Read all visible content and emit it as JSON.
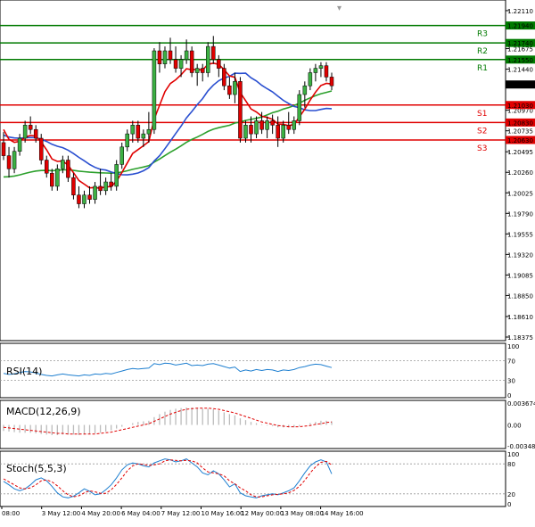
{
  "chart_data": [
    {
      "type": "candlestick",
      "title": "",
      "ylim": [
        1.18375,
        1.2215
      ],
      "yticks": [
        "1.22110",
        "1.21675",
        "1.21440",
        "1.21265",
        "1.20970",
        "1.20735",
        "1.20495",
        "1.20260",
        "1.20025",
        "1.19790",
        "1.19555",
        "1.19320",
        "1.19085",
        "1.18850",
        "1.18610",
        "1.18375"
      ],
      "xticks": [
        "08:00",
        "3 May 12:00",
        "4 May 20:00",
        "6 May 04:00",
        "7 May 12:00",
        "10 May 16:00",
        "12 May 00:00",
        "13 May 08:00",
        "14 May 16:00"
      ],
      "last_price": "1.21265",
      "levels": [
        {
          "name": "R3",
          "value": 1.2194,
          "label": "1.21940",
          "color": "#007a00"
        },
        {
          "name": "R2",
          "value": 1.2174,
          "label": "1.21740",
          "color": "#007a00"
        },
        {
          "name": "R1",
          "value": 1.2155,
          "label": "1.21550",
          "color": "#007a00"
        },
        {
          "name": "S1",
          "value": 1.2103,
          "label": "1.21030",
          "color": "#e00000"
        },
        {
          "name": "S2",
          "value": 1.2083,
          "label": "1.20830",
          "color": "#e00000"
        },
        {
          "name": "S3",
          "value": 1.2063,
          "label": "1.20630",
          "color": "#e00000"
        }
      ],
      "candles": [
        [
          1.206,
          1.2072,
          1.204,
          1.2045
        ],
        [
          1.2045,
          1.2055,
          1.202,
          1.203
        ],
        [
          1.203,
          1.2055,
          1.2025,
          1.205
        ],
        [
          1.205,
          1.207,
          1.2045,
          1.2065
        ],
        [
          1.2065,
          1.2085,
          1.206,
          1.208
        ],
        [
          1.208,
          1.209,
          1.207,
          1.2075
        ],
        [
          1.2075,
          1.208,
          1.206,
          1.2065
        ],
        [
          1.2065,
          1.207,
          1.2035,
          1.204
        ],
        [
          1.204,
          1.2045,
          1.202,
          1.2025
        ],
        [
          1.2025,
          1.203,
          1.2005,
          1.201
        ],
        [
          1.201,
          1.2035,
          1.2005,
          1.203
        ],
        [
          1.203,
          1.2045,
          1.2025,
          1.204
        ],
        [
          1.204,
          1.2045,
          1.2015,
          1.202
        ],
        [
          1.202,
          1.2025,
          1.1995,
          1.2
        ],
        [
          1.2,
          1.201,
          1.1985,
          1.199
        ],
        [
          1.199,
          1.2005,
          1.1985,
          1.2
        ],
        [
          1.2,
          1.201,
          1.199,
          1.1995
        ],
        [
          1.1995,
          1.2015,
          1.199,
          1.201
        ],
        [
          1.201,
          1.203,
          1.2,
          1.2005
        ],
        [
          1.2005,
          1.202,
          1.2,
          1.2015
        ],
        [
          1.2015,
          1.2025,
          1.2005,
          1.201
        ],
        [
          1.201,
          1.204,
          1.2005,
          1.2035
        ],
        [
          1.2035,
          1.206,
          1.203,
          1.2055
        ],
        [
          1.2055,
          1.2075,
          1.205,
          1.207
        ],
        [
          1.207,
          1.2085,
          1.206,
          1.208
        ],
        [
          1.208,
          1.2085,
          1.206,
          1.2065
        ],
        [
          1.2065,
          1.2075,
          1.2055,
          1.207
        ],
        [
          1.207,
          1.2095,
          1.206,
          1.2075
        ],
        [
          1.2075,
          1.2168,
          1.207,
          1.2165
        ],
        [
          1.2165,
          1.2175,
          1.214,
          1.215
        ],
        [
          1.215,
          1.217,
          1.2145,
          1.2165
        ],
        [
          1.2165,
          1.218,
          1.215,
          1.2155
        ],
        [
          1.2155,
          1.217,
          1.214,
          1.2145
        ],
        [
          1.2145,
          1.216,
          1.2135,
          1.2155
        ],
        [
          1.2155,
          1.2178,
          1.215,
          1.2165
        ],
        [
          1.2165,
          1.217,
          1.2135,
          1.214
        ],
        [
          1.214,
          1.215,
          1.2125,
          1.2145
        ],
        [
          1.2145,
          1.215,
          1.213,
          1.214
        ],
        [
          1.214,
          1.2175,
          1.2135,
          1.217
        ],
        [
          1.217,
          1.2182,
          1.215,
          1.2155
        ],
        [
          1.2155,
          1.216,
          1.2135,
          1.2145
        ],
        [
          1.2145,
          1.215,
          1.212,
          1.2125
        ],
        [
          1.2125,
          1.2135,
          1.211,
          1.2115
        ],
        [
          1.2115,
          1.214,
          1.2105,
          1.213
        ],
        [
          1.213,
          1.2135,
          1.206,
          1.2065
        ],
        [
          1.2065,
          1.2085,
          1.206,
          1.208
        ],
        [
          1.208,
          1.209,
          1.206,
          1.207
        ],
        [
          1.207,
          1.209,
          1.2065,
          1.2085
        ],
        [
          1.2085,
          1.2095,
          1.207,
          1.2075
        ],
        [
          1.2075,
          1.209,
          1.2065,
          1.2085
        ],
        [
          1.2085,
          1.2092,
          1.207,
          1.208
        ],
        [
          1.208,
          1.209,
          1.2055,
          1.2065
        ],
        [
          1.2065,
          1.2085,
          1.206,
          1.208
        ],
        [
          1.208,
          1.2095,
          1.207,
          1.2075
        ],
        [
          1.2075,
          1.209,
          1.207,
          1.2085
        ],
        [
          1.2085,
          1.212,
          1.208,
          1.2115
        ],
        [
          1.2115,
          1.213,
          1.21,
          1.2125
        ],
        [
          1.2125,
          1.2145,
          1.212,
          1.214
        ],
        [
          1.214,
          1.215,
          1.213,
          1.2145
        ],
        [
          1.2145,
          1.2152,
          1.2135,
          1.2148
        ],
        [
          1.2148,
          1.2152,
          1.213,
          1.2135
        ],
        [
          1.2135,
          1.214,
          1.212,
          1.2125
        ]
      ],
      "indicators": {
        "ema_fast_color": "#e00000",
        "ma_mid_color": "#2a4fd0",
        "ma_slow_color": "#2ca02c"
      }
    },
    {
      "type": "line",
      "title": "RSI(14)",
      "ylim": [
        0,
        100
      ],
      "yticks": [
        "100",
        "70",
        "30",
        "0"
      ],
      "levels": [
        70,
        30
      ],
      "values": [
        44,
        42,
        43,
        46,
        48,
        47,
        45,
        42,
        40,
        39,
        41,
        43,
        41,
        40,
        39,
        41,
        40,
        43,
        42,
        44,
        43,
        46,
        49,
        52,
        54,
        53,
        54,
        55,
        64,
        62,
        65,
        64,
        61,
        63,
        65,
        60,
        61,
        60,
        63,
        64,
        61,
        58,
        55,
        57,
        48,
        51,
        49,
        52,
        50,
        52,
        51,
        48,
        51,
        50,
        52,
        56,
        58,
        61,
        63,
        62,
        59,
        56
      ],
      "color": "#1e7fd0"
    },
    {
      "type": "bar",
      "title": "MACD(12,26,9)",
      "ylim": [
        -0.00348,
        0.00364
      ],
      "yticks": [
        "0.003674",
        "0.00",
        "-0.003486"
      ],
      "histogram": [
        -0.001,
        -0.0011,
        -0.0012,
        -0.0013,
        -0.0013,
        -0.0013,
        -0.0014,
        -0.0015,
        -0.0016,
        -0.0017,
        -0.0017,
        -0.0016,
        -0.0016,
        -0.0016,
        -0.0017,
        -0.0016,
        -0.0015,
        -0.0014,
        -0.0013,
        -0.0011,
        -0.0009,
        -0.0006,
        -0.0003,
        0.0,
        0.0003,
        0.0005,
        0.0006,
        0.0007,
        0.0013,
        0.0018,
        0.0022,
        0.0025,
        0.0027,
        0.0028,
        0.0029,
        0.0029,
        0.0028,
        0.0027,
        0.0027,
        0.0026,
        0.0024,
        0.0021,
        0.0018,
        0.0016,
        0.0011,
        0.0008,
        0.0005,
        0.0003,
        0.0001,
        -0.0001,
        -0.0002,
        -0.0004,
        -0.0004,
        -0.0004,
        -0.0004,
        -0.0002,
        0.0,
        0.0003,
        0.0005,
        0.0007,
        0.0007,
        0.0006
      ],
      "signal": [
        -0.0004,
        -0.0005,
        -0.0006,
        -0.0007,
        -0.0008,
        -0.0009,
        -0.001,
        -0.0011,
        -0.0012,
        -0.0013,
        -0.0014,
        -0.0014,
        -0.0015,
        -0.0015,
        -0.0015,
        -0.0015,
        -0.0015,
        -0.0015,
        -0.0014,
        -0.0013,
        -0.0012,
        -0.001,
        -0.0008,
        -0.0006,
        -0.0004,
        -0.0002,
        0.0,
        0.0002,
        0.0006,
        0.001,
        0.0014,
        0.0018,
        0.0021,
        0.0024,
        0.0026,
        0.0027,
        0.0028,
        0.0028,
        0.0028,
        0.0027,
        0.0026,
        0.0024,
        0.0022,
        0.002,
        0.0017,
        0.0014,
        0.0011,
        0.0008,
        0.0005,
        0.0003,
        0.0001,
        -0.0001,
        -0.0002,
        -0.0003,
        -0.0003,
        -0.0003,
        -0.0002,
        -0.0001,
        0.0001,
        0.0002,
        0.0004,
        0.0005
      ],
      "bar_color": "#bbbbbb",
      "signal_color": "#e00000"
    },
    {
      "type": "line",
      "title": "Stoch(5,5,3)",
      "ylim": [
        0,
        100
      ],
      "yticks": [
        "100",
        "80",
        "20",
        "0"
      ],
      "levels": [
        80,
        20
      ],
      "k": [
        45,
        38,
        30,
        26,
        30,
        38,
        48,
        52,
        46,
        35,
        22,
        14,
        12,
        15,
        22,
        30,
        25,
        18,
        20,
        28,
        38,
        52,
        68,
        78,
        82,
        80,
        76,
        74,
        82,
        86,
        90,
        88,
        84,
        86,
        90,
        82,
        74,
        62,
        58,
        66,
        60,
        48,
        34,
        40,
        22,
        16,
        14,
        12,
        16,
        18,
        20,
        18,
        22,
        26,
        32,
        46,
        62,
        76,
        84,
        88,
        84,
        60
      ],
      "d": [
        50,
        44,
        38,
        32,
        30,
        32,
        38,
        46,
        48,
        44,
        36,
        26,
        18,
        14,
        16,
        22,
        26,
        24,
        21,
        21,
        28,
        39,
        52,
        66,
        76,
        80,
        79,
        77,
        78,
        80,
        86,
        88,
        87,
        86,
        87,
        86,
        82,
        72,
        64,
        62,
        60,
        56,
        46,
        40,
        32,
        26,
        18,
        14,
        14,
        16,
        18,
        19,
        20,
        22,
        27,
        35,
        47,
        62,
        74,
        83,
        85,
        78
      ],
      "k_color": "#1e7fd0",
      "d_color": "#e00000"
    }
  ]
}
